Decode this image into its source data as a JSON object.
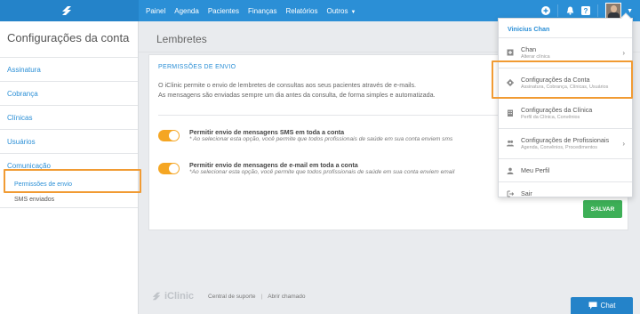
{
  "topbar": {
    "nav": [
      "Painel",
      "Agenda",
      "Pacientes",
      "Finanças",
      "Relatórios",
      "Outros"
    ]
  },
  "sidebar": {
    "title": "Configurações da conta",
    "items": [
      "Assinatura",
      "Cobrança",
      "Clínicas",
      "Usuários",
      "Comunicação"
    ],
    "subitems": [
      "Permissões de envio",
      "SMS enviados"
    ]
  },
  "main": {
    "title": "Lembretes",
    "card": {
      "heading": "PERMISSÕES DE ENVIO",
      "desc1": "O iClinic permite o envio de lembretes de consultas aos seus pacientes através de e-mails.",
      "desc2": "As mensagens são enviadas sempre um dia antes da consulta, de forma simples e automatizada.",
      "options": [
        {
          "title": "Permitir envio de mensagens SMS em toda a conta",
          "note": "* Ao selecionar esta opção, você permite que todos profissionais de saúde em sua conta enviem sms",
          "enabled": true
        },
        {
          "title": "Permitir envio de mensagens de e-mail em toda a conta",
          "note": "*Ao selecionar esta opção, você permite que todos profissionais de saúde em sua conta enviem email",
          "enabled": true
        }
      ],
      "save_label": "SALVAR"
    }
  },
  "footer": {
    "logo_text": "iClinic",
    "support": "Central de suporte",
    "divider": "|",
    "ticket": "Abrir chamado",
    "chat": "Chat"
  },
  "dropdown": {
    "user": "Vinicius Chan",
    "items": [
      {
        "label": "Chan",
        "sub": "Alterar clínica",
        "icon": "clinic-switch-icon",
        "arrow": true
      },
      {
        "label": "Configurações da Conta",
        "sub": "Assinatura, Cobrança, Clínicas, Usuários",
        "icon": "gear-icon",
        "arrow": false
      },
      {
        "label": "Configurações da Clínica",
        "sub": "Perfil da Clínica, Convênios",
        "icon": "building-icon",
        "arrow": false
      },
      {
        "label": "Configurações de Profissionais",
        "sub": "Agenda, Convênios, Procedimentos",
        "icon": "users-icon",
        "arrow": true
      },
      {
        "label": "Meu Perfil",
        "sub": "",
        "icon": "user-icon",
        "arrow": false
      },
      {
        "label": "Sair",
        "sub": "",
        "icon": "logout-icon",
        "arrow": false
      }
    ]
  },
  "colors": {
    "primary": "#2b8fd6",
    "toggle_on": "#f5a623",
    "save": "#3daf57",
    "highlight": "#f19b33"
  }
}
